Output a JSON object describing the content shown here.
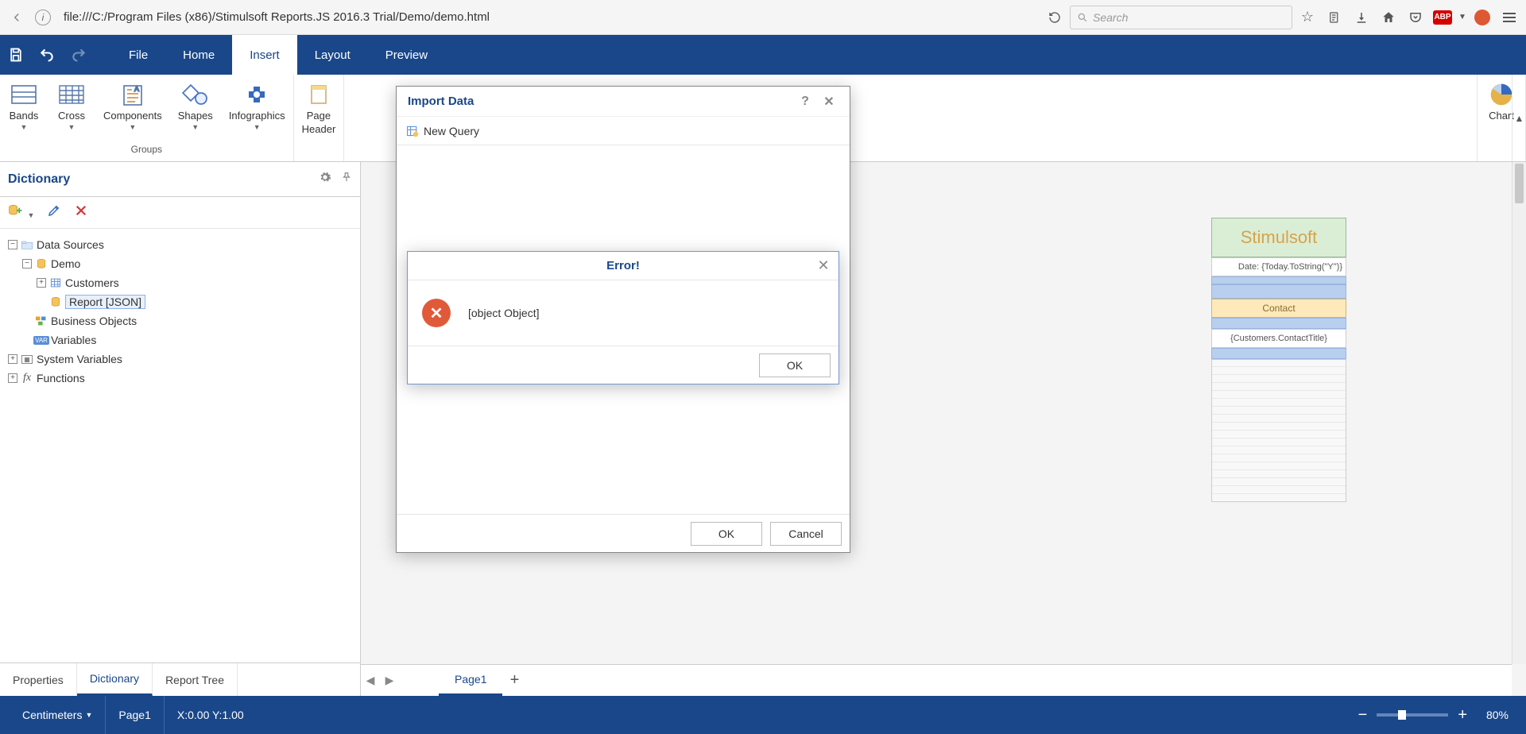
{
  "browser": {
    "url": "file:///C:/Program Files (x86)/Stimulsoft Reports.JS 2016.3 Trial/Demo/demo.html",
    "search_placeholder": "Search",
    "abp_label": "ABP"
  },
  "ribbon": {
    "tabs": {
      "file": "File",
      "home": "Home",
      "insert": "Insert",
      "layout": "Layout",
      "preview": "Preview"
    },
    "buttons": {
      "bands": "Bands",
      "cross": "Cross",
      "components": "Components",
      "shapes": "Shapes",
      "infographics": "Infographics",
      "page_header_1": "Page",
      "page_header_2": "Header",
      "chart": "Chart"
    },
    "groups": {
      "groups": "Groups"
    }
  },
  "dictionary": {
    "title": "Dictionary",
    "tree": {
      "data_sources": "Data Sources",
      "demo": "Demo",
      "customers": "Customers",
      "report_json": "Report [JSON]",
      "business_objects": "Business Objects",
      "variables": "Variables",
      "system_variables": "System Variables",
      "functions": "Functions"
    },
    "tabs": {
      "properties": "Properties",
      "dictionary": "Dictionary",
      "report_tree": "Report Tree"
    }
  },
  "import_dialog": {
    "title": "Import Data",
    "new_query": "New Query",
    "ok": "OK",
    "cancel": "Cancel"
  },
  "error_dialog": {
    "title": "Error!",
    "message": "[object Object]",
    "ok": "OK"
  },
  "design": {
    "page_tab": "Page1",
    "report": {
      "title": "Stimulsoft",
      "date_expr": "Date: {Today.ToString(\"Y\")}",
      "contact_header": "Contact",
      "contact_title_expr": "{Customers.ContactTitle}"
    }
  },
  "status": {
    "unit": "Centimeters",
    "page": "Page1",
    "coords": "X:0.00 Y:1.00",
    "zoom": "80%"
  }
}
